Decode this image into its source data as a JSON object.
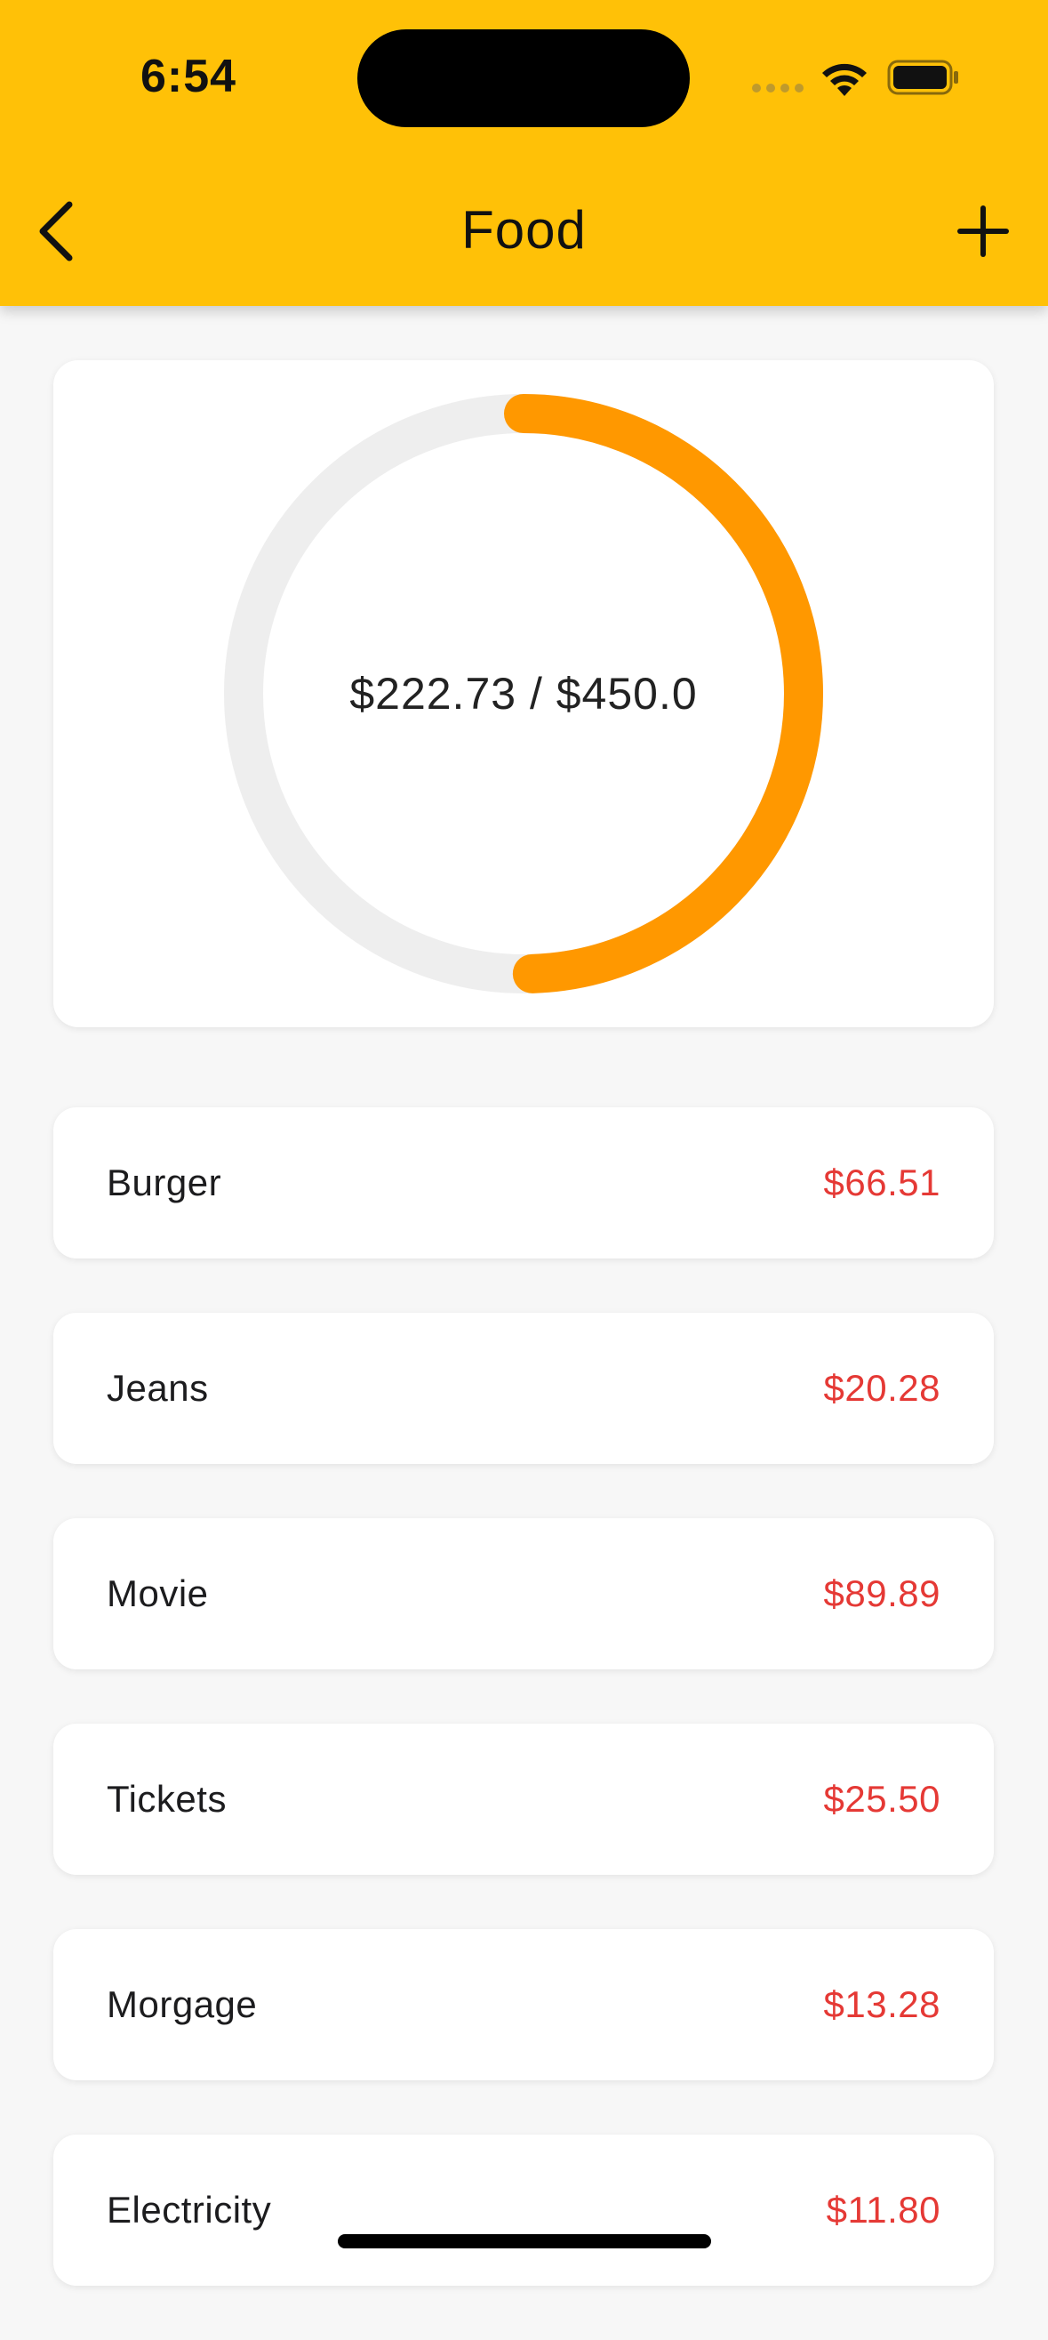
{
  "status_bar": {
    "time": "6:54"
  },
  "app_bar": {
    "title": "Food",
    "back_icon": "chevron-left-icon",
    "add_icon": "plus-icon"
  },
  "budget": {
    "spent": 222.73,
    "limit": 450.0,
    "summary_text": "$222.73 / $450.0"
  },
  "expenses": [
    {
      "name": "Burger",
      "amount": "$66.51"
    },
    {
      "name": "Jeans",
      "amount": "$20.28"
    },
    {
      "name": "Movie",
      "amount": "$89.89"
    },
    {
      "name": "Tickets",
      "amount": "$25.50"
    },
    {
      "name": "Morgage",
      "amount": "$13.28"
    },
    {
      "name": "Electricity",
      "amount": "$11.80"
    }
  ],
  "colors": {
    "header": "#ffc107",
    "ring_progress": "#ff9800",
    "ring_track": "#eeeeee",
    "amount": "#e53935",
    "background": "#f7f7f7"
  }
}
